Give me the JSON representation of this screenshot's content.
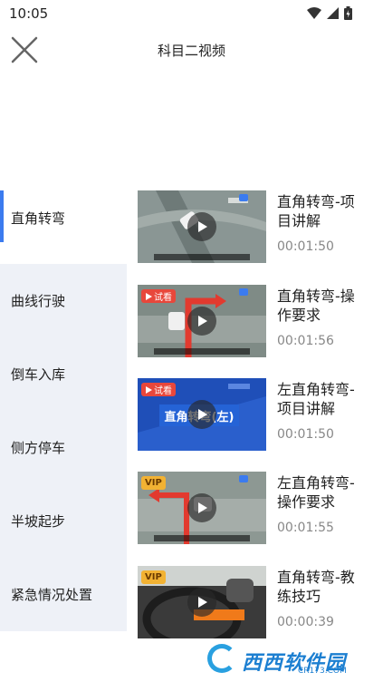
{
  "status": {
    "time": "10:05"
  },
  "header": {
    "title": "科目二视频"
  },
  "sidebar": {
    "items": [
      {
        "label": "直角转弯",
        "active": true
      },
      {
        "label": "曲线行驶"
      },
      {
        "label": "倒车入库"
      },
      {
        "label": "侧方停车"
      },
      {
        "label": "半坡起步"
      },
      {
        "label": "紧急情况处置"
      }
    ]
  },
  "videos": [
    {
      "title": "直角转弯-项目讲解",
      "duration": "00:01:50",
      "badge": ""
    },
    {
      "title": "直角转弯-操作要求",
      "duration": "00:01:56",
      "badge": "试看"
    },
    {
      "title": "左直角转弯-项目讲解",
      "duration": "00:01:50",
      "badge": "试看",
      "thumb_text": "直角转弯(左)"
    },
    {
      "title": "左直角转弯-操作要求",
      "duration": "00:01:55",
      "badge": "VIP"
    },
    {
      "title": "直角转弯-教练技巧",
      "duration": "00:00:39",
      "badge": "VIP"
    }
  ],
  "watermark": {
    "text": "西西软件园",
    "sub": "CR173.COM"
  },
  "colors": {
    "accent": "#3b7bef",
    "sidebar_bg": "#eef1f7",
    "trial": "#e8473b",
    "vip": "#f2b233"
  }
}
